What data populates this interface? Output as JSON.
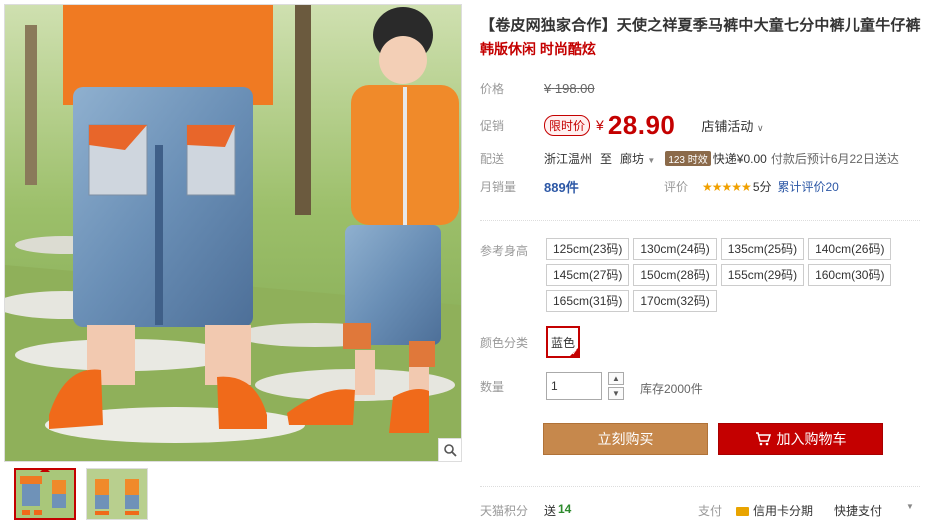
{
  "product": {
    "title": "【卷皮网独家合作】天使之祥夏季马裤中大童七分中裤儿童牛仔裤",
    "subtitle": "韩版休闲 时尚酷炫"
  },
  "price": {
    "label": "价格",
    "currency": "¥",
    "original": "198.00"
  },
  "promo": {
    "label": "促销",
    "badge": "限时价",
    "currency": "¥",
    "price": "28.90",
    "shop_activity": "店铺活动"
  },
  "shipping": {
    "label": "配送",
    "from": "浙江温州",
    "to_word": "至",
    "to": "廊坊",
    "badge": "123 时效",
    "express": "快递¥0.00",
    "estimate": "付款后预计6月22日送达"
  },
  "sales": {
    "label": "月销量",
    "count": "889件",
    "rating_label": "评价",
    "stars": "★★★★★",
    "rating": "5分",
    "review_text": "累计评价20"
  },
  "sizes": {
    "label": "参考身高",
    "options": [
      "125cm(23码)",
      "130cm(24码)",
      "135cm(25码)",
      "140cm(26码)",
      "145cm(27码)",
      "150cm(28码)",
      "155cm(29码)",
      "160cm(30码)",
      "165cm(31码)",
      "170cm(32码)"
    ]
  },
  "color": {
    "label": "颜色分类",
    "options": [
      "蓝色"
    ],
    "selected": "蓝色"
  },
  "quantity": {
    "label": "数量",
    "value": "1",
    "stock": "库存2000件"
  },
  "buttons": {
    "buy_now": "立刻购买",
    "add_to_cart": "加入购物车"
  },
  "footer": {
    "points_label": "天猫积分",
    "points_prefix": "送",
    "points_value": "14",
    "pay_label": "支付",
    "credit_installment": "信用卡分期",
    "quick_pay": "快捷支付"
  },
  "colors": {
    "accent_red": "#c40000",
    "buy_button": "#c6884c",
    "link_blue": "#2d58a6",
    "star_orange": "#f0a000"
  },
  "icons": [
    "magnifier-icon",
    "cart-icon",
    "chevron-down-icon",
    "credit-card-icon"
  ]
}
